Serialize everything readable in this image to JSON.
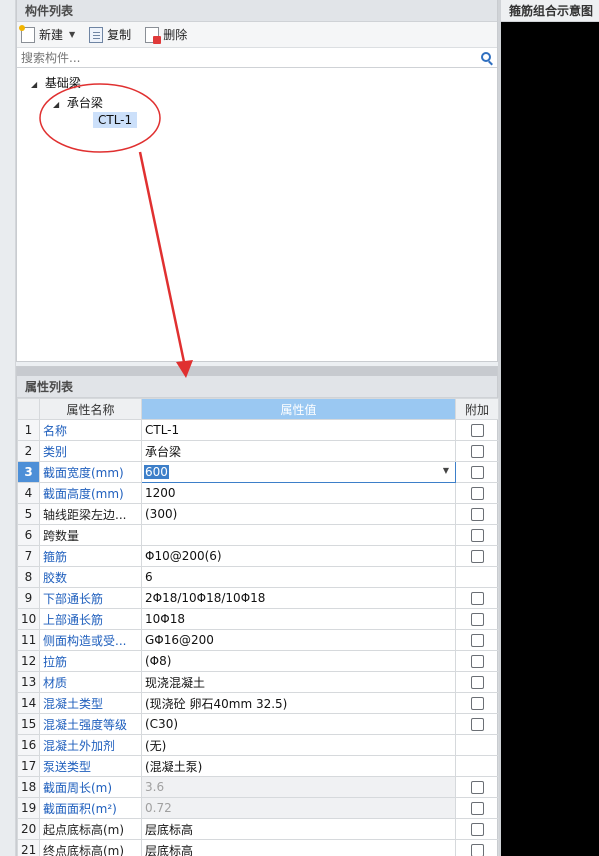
{
  "component_panel": {
    "title": "构件列表",
    "toolbar": {
      "new_label": "新建",
      "copy_label": "复制",
      "delete_label": "删除"
    },
    "search": {
      "placeholder": "搜索构件..."
    },
    "tree": {
      "root": "基础梁",
      "child": "承台梁",
      "leaf": "CTL-1"
    }
  },
  "diagram_panel": {
    "title": "箍筋组合示意图"
  },
  "property_panel": {
    "title": "属性列表",
    "columns": {
      "index": "",
      "name": "属性名称",
      "value": "属性值",
      "extra": "附加"
    },
    "rows": [
      {
        "n": "1",
        "name": "名称",
        "value": "CTL-1",
        "blue": true,
        "checkbox": true,
        "gray": false
      },
      {
        "n": "2",
        "name": "类别",
        "value": "承台梁",
        "blue": true,
        "checkbox": true,
        "gray": false
      },
      {
        "n": "3",
        "name": "截面宽度(mm)",
        "value": "600",
        "blue": true,
        "checkbox": true,
        "gray": false,
        "editing": true
      },
      {
        "n": "4",
        "name": "截面高度(mm)",
        "value": "1200",
        "blue": true,
        "checkbox": true,
        "gray": false
      },
      {
        "n": "5",
        "name": "轴线距梁左边...",
        "value": "(300)",
        "blue": false,
        "checkbox": true,
        "gray": false
      },
      {
        "n": "6",
        "name": "跨数量",
        "value": "",
        "blue": false,
        "checkbox": true,
        "gray": false
      },
      {
        "n": "7",
        "name": "箍筋",
        "value": "Φ10@200(6)",
        "blue": true,
        "checkbox": true,
        "gray": false
      },
      {
        "n": "8",
        "name": "胶数",
        "value": "6",
        "blue": true,
        "checkbox": false,
        "gray": false
      },
      {
        "n": "9",
        "name": "下部通长筋",
        "value": "2Φ18/10Φ18/10Φ18",
        "blue": true,
        "checkbox": true,
        "gray": false
      },
      {
        "n": "10",
        "name": "上部通长筋",
        "value": "10Φ18",
        "blue": true,
        "checkbox": true,
        "gray": false
      },
      {
        "n": "11",
        "name": "侧面构造或受...",
        "value": "GΦ16@200",
        "blue": true,
        "checkbox": true,
        "gray": false
      },
      {
        "n": "12",
        "name": "拉筋",
        "value": "(Φ8)",
        "blue": true,
        "checkbox": true,
        "gray": false
      },
      {
        "n": "13",
        "name": "材质",
        "value": "现浇混凝土",
        "blue": true,
        "checkbox": true,
        "gray": false
      },
      {
        "n": "14",
        "name": "混凝土类型",
        "value": "(现浇砼 卵石40mm 32.5)",
        "blue": true,
        "checkbox": true,
        "gray": false
      },
      {
        "n": "15",
        "name": "混凝土强度等级",
        "value": "(C30)",
        "blue": true,
        "checkbox": true,
        "gray": false
      },
      {
        "n": "16",
        "name": "混凝土外加剂",
        "value": "(无)",
        "blue": true,
        "checkbox": false,
        "gray": false
      },
      {
        "n": "17",
        "name": "泵送类型",
        "value": "(混凝土泵)",
        "blue": true,
        "checkbox": false,
        "gray": false
      },
      {
        "n": "18",
        "name": "截面周长(m)",
        "value": "3.6",
        "blue": true,
        "checkbox": true,
        "gray": true
      },
      {
        "n": "19",
        "name": "截面面积(m²)",
        "value": "0.72",
        "blue": true,
        "checkbox": true,
        "gray": true
      },
      {
        "n": "20",
        "name": "起点底标高(m)",
        "value": "层底标高",
        "blue": false,
        "checkbox": true,
        "gray": false
      },
      {
        "n": "21",
        "name": "终点底标高(m)",
        "value": "层底标高",
        "blue": false,
        "checkbox": true,
        "gray": false
      }
    ]
  },
  "colors": {
    "accent_blue": "#3d7fc9",
    "header_value_blue": "#9ac8f2",
    "annotation_red": "#e03030",
    "link_blue": "#1f5fbd"
  }
}
